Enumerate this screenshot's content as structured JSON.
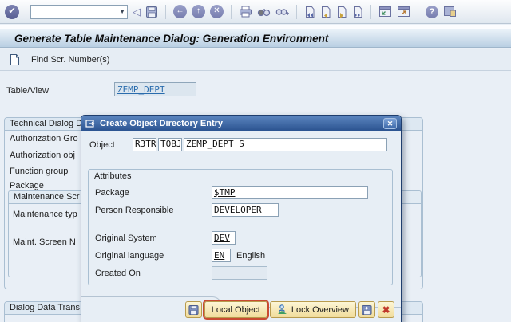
{
  "glyphs": {
    "check": "✔",
    "dropdown": "▼",
    "back_triangle": "◁",
    "arrow_left": "←",
    "arrow_up": "↑",
    "cancel_x": "✕",
    "question": "?",
    "close_x": "✕",
    "red_x": "✖"
  },
  "window_title": "Generate Table Maintenance Dialog: Generation Environment",
  "toolbar": {
    "command_value": "",
    "icons": [
      "enter",
      "command-field",
      "collapse",
      "save",
      "back",
      "exit",
      "cancel",
      "print",
      "find",
      "find-next",
      "first-page",
      "previous-page",
      "next-page",
      "last-page",
      "new-session",
      "create-shortcut",
      "help",
      "customize-layout"
    ]
  },
  "app_toolbar": {
    "find_button": "Find Scr. Number(s)"
  },
  "main": {
    "table_view_label": "Table/View",
    "table_view_value": "ZEMP_DEPT"
  },
  "background": {
    "group1_header": "Technical Dialog D",
    "label_auth_group": "Authorization Gro",
    "label_auth_obj": "Authorization obj",
    "label_function_group": "Function group",
    "label_package": "Package",
    "inner_header": "Maintenance Scr",
    "label_maintenance_type": "Maintenance typ",
    "label_maint_screen_no": "Maint. Screen N",
    "group2_header": "Dialog Data Trans"
  },
  "dialog": {
    "title": "Create Object Directory Entry",
    "object_label": "Object",
    "object_type1": "R3TR",
    "object_type2": "TOBJ",
    "object_name": "ZEMP_DEPT S",
    "attributes": {
      "section_title": "Attributes",
      "package_label": "Package",
      "package_value": "$TMP",
      "person_label": "Person Responsible",
      "person_value": "DEVELOPER",
      "orig_system_label": "Original System",
      "orig_system_value": "DEV",
      "orig_lang_label": "Original language",
      "orig_lang_value": "EN",
      "orig_lang_text": "English",
      "created_on_label": "Created On",
      "created_on_value": ""
    },
    "buttons": {
      "local_object": "Local Object",
      "lock_overview": "Lock Overview"
    }
  },
  "colors": {
    "titlebar_blue": "#2b5390",
    "button_face": "#f1dc9b",
    "focus_outline": "#c94b32",
    "value_blue": "#2a6cad",
    "icon_purple": "#767cae"
  }
}
